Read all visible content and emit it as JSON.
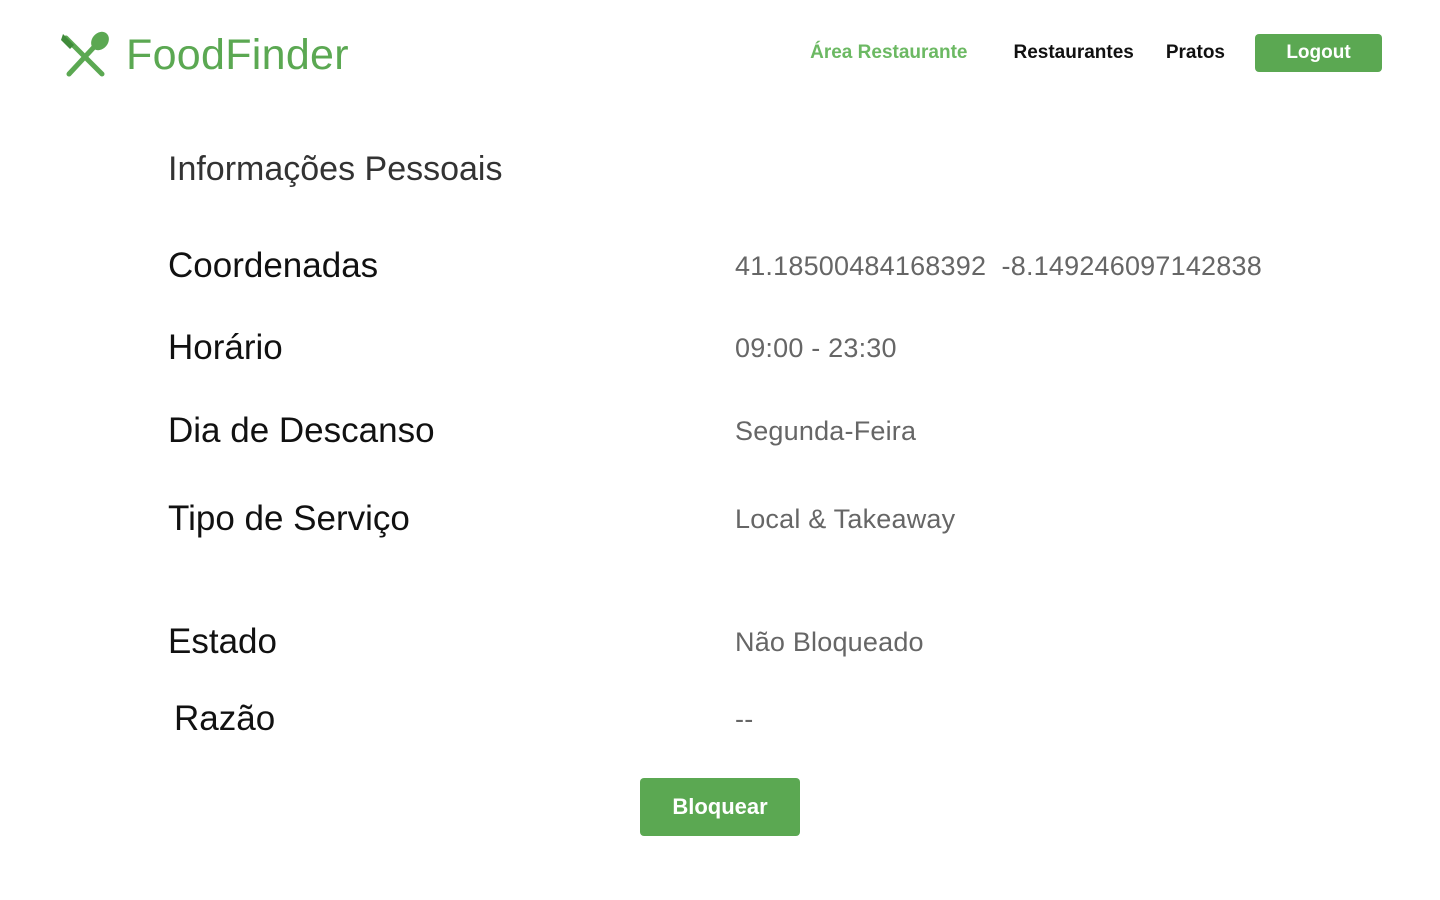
{
  "brand": {
    "name": "FoodFinder",
    "icon": "spoon-fork-icon",
    "color": "#5ba852"
  },
  "nav": {
    "items": [
      {
        "label": "Área Restaurante",
        "active": true
      },
      {
        "label": "Restaurantes",
        "active": false
      },
      {
        "label": "Pratos",
        "active": false
      }
    ],
    "logout_label": "Logout",
    "active_color": "#6cb963"
  },
  "section": {
    "title": "Informações Pessoais"
  },
  "info": {
    "coordenadas": {
      "label": "Coordenadas",
      "value": "41.18500484168392  -8.149246097142838"
    },
    "horario": {
      "label": "Horário",
      "value": "09:00 - 23:30"
    },
    "descanso": {
      "label": "Dia de Descanso",
      "value": "Segunda-Feira"
    },
    "servico": {
      "label": "Tipo de Serviço",
      "value": "Local & Takeaway"
    },
    "estado": {
      "label": "Estado",
      "value": "Não Bloqueado"
    },
    "razao": {
      "label": "Razão",
      "value": "--"
    }
  },
  "actions": {
    "block_label": "Bloquear"
  }
}
